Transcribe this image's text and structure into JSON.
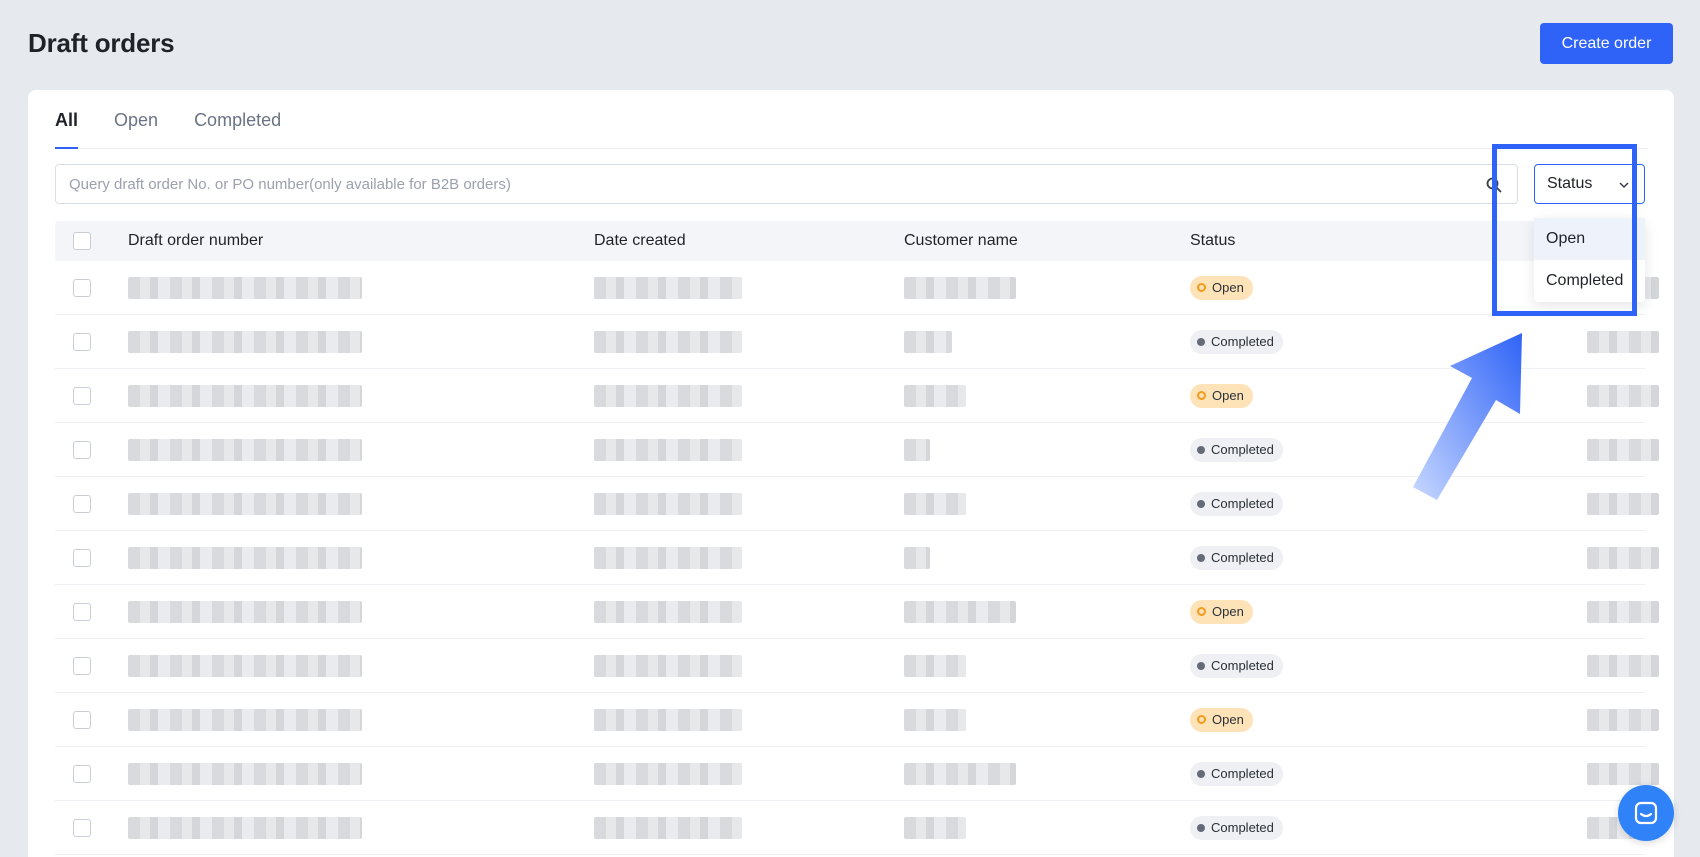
{
  "header": {
    "title": "Draft orders",
    "create_button": "Create order"
  },
  "tabs": [
    {
      "label": "All",
      "active": true
    },
    {
      "label": "Open",
      "active": false
    },
    {
      "label": "Completed",
      "active": false
    }
  ],
  "search": {
    "placeholder": "Query draft order No. or PO number(only available for B2B orders)",
    "value": ""
  },
  "status_filter": {
    "label": "Status",
    "options": [
      "Open",
      "Completed"
    ],
    "open": true
  },
  "table": {
    "columns": [
      "Draft order number",
      "Date created",
      "Customer name",
      "Status"
    ],
    "rows": [
      {
        "status": "Open"
      },
      {
        "status": "Completed"
      },
      {
        "status": "Open"
      },
      {
        "status": "Completed"
      },
      {
        "status": "Completed"
      },
      {
        "status": "Completed"
      },
      {
        "status": "Open"
      },
      {
        "status": "Completed"
      },
      {
        "status": "Open"
      },
      {
        "status": "Completed"
      },
      {
        "status": "Completed"
      }
    ]
  },
  "colors": {
    "accent": "#2f63f7",
    "open_badge": "#ffe3b8",
    "completed_badge": "#eef0f3"
  }
}
